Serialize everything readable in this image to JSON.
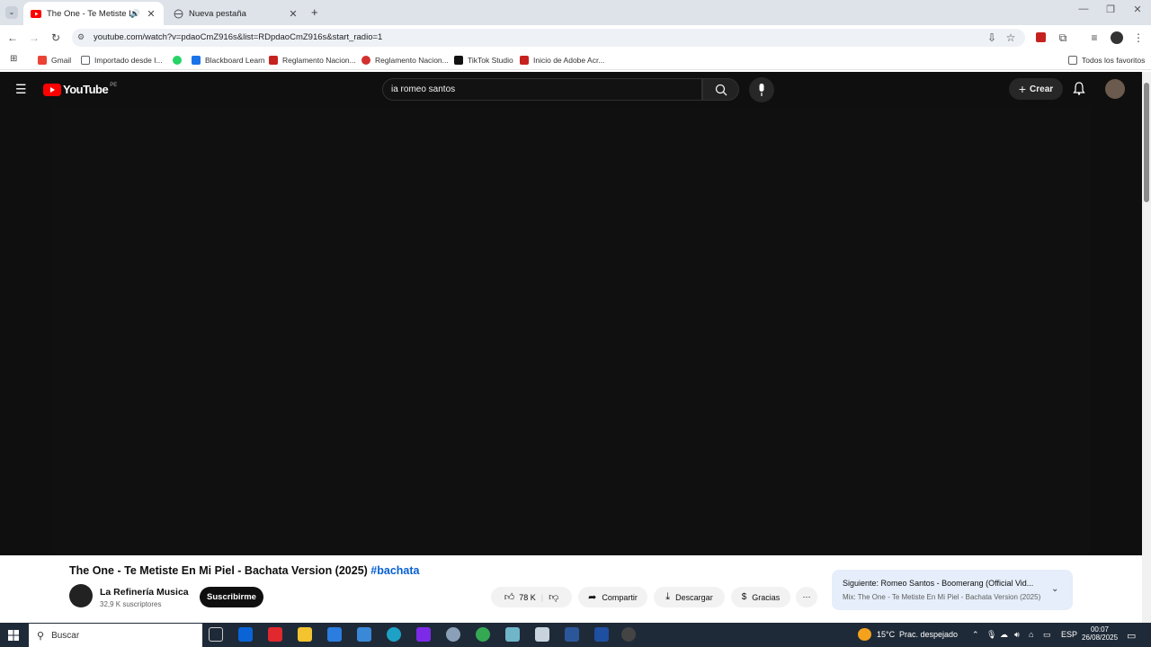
{
  "browser": {
    "tabs": [
      {
        "title": "The One - Te Metiste En Mi Piel",
        "active": true
      },
      {
        "title": "Nueva pestaña",
        "active": false
      }
    ],
    "url": "youtube.com/watch?v=pdaoCmZ916s&list=RDpdaoCmZ916s&start_radio=1",
    "bookmarks": [
      {
        "label": "Gmail",
        "color": "#ea4335"
      },
      {
        "label": "Importado desde I...",
        "color": "#5f6368"
      },
      {
        "label": "",
        "color": "#25d366"
      },
      {
        "label": "Blackboard Learn",
        "color": "#1a73e8"
      },
      {
        "label": "Reglamento Nacion...",
        "color": "#c5221f"
      },
      {
        "label": "Reglamento Nacion...",
        "color": "#d32f2f"
      },
      {
        "label": "TikTok Studio",
        "color": "#111111"
      },
      {
        "label": "Inicio de Adobe Acr...",
        "color": "#c5221f"
      }
    ],
    "all_bookmarks": "Todos los favoritos"
  },
  "youtube": {
    "logo_text": "YouTube",
    "country": "PE",
    "search_query": "ia romeo santos",
    "create_label": "Crear",
    "video": {
      "title": "The One - Te Metiste En Mi Piel - Bachata Version (2025)",
      "hashtag": "#bachata",
      "channel": "La Refinería Musica",
      "subscribers": "32,9 K suscriptores",
      "subscribe_label": "Suscribirme",
      "likes": "78 K",
      "share_label": "Compartir",
      "download_label": "Descargar",
      "thanks_label": "Gracias"
    },
    "next": {
      "label": "Siguiente:",
      "title": "Romeo Santos - Boomerang (Official Vid...",
      "mix": "Mix: The One - Te Metiste En Mi Piel - Bachata Version (2025)"
    }
  },
  "taskbar": {
    "search_placeholder": "Buscar",
    "weather": "15°C",
    "weather_desc": "Prac. despejado",
    "lang": "ESP",
    "time": "00:07",
    "date": "26/08/2025"
  }
}
